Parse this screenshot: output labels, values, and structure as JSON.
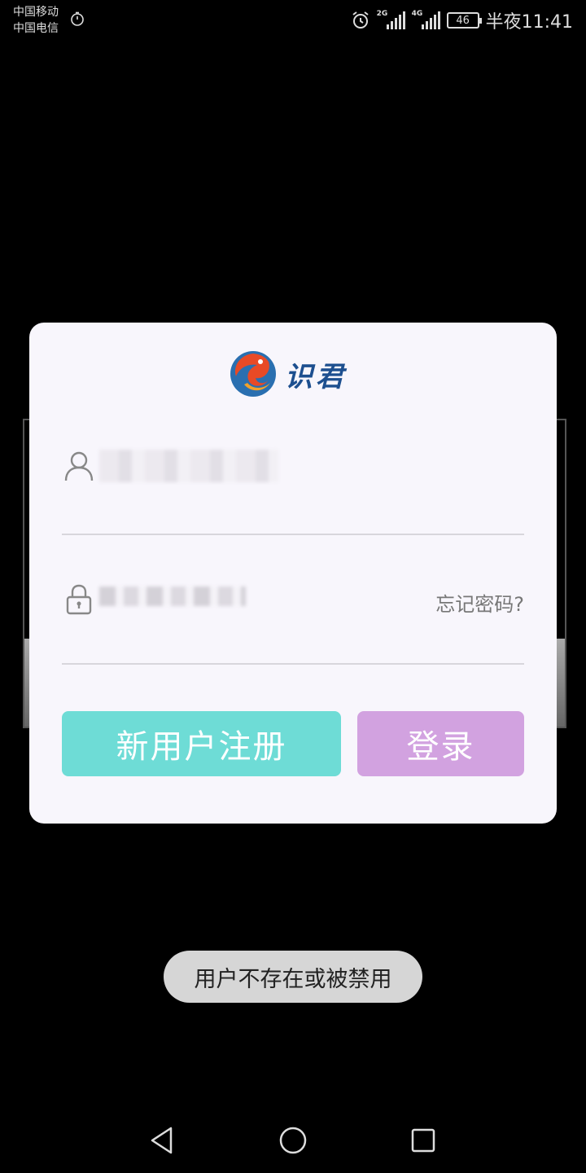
{
  "status_bar": {
    "carrier_1": "中国移动",
    "carrier_2": "中国电信",
    "signal_1_tag": "2G",
    "signal_2_tag": "4G",
    "battery": "46",
    "time": "半夜11:41"
  },
  "dialog": {
    "logo_text": "识君",
    "username_value": "",
    "password_value": "",
    "forgot_password": "忘记密码?",
    "register_button": "新用户注册",
    "login_button": "登录"
  },
  "toast": {
    "message": "用户不存在或被禁用"
  },
  "colors": {
    "register": "#6edcd6",
    "login": "#d2a2e0",
    "dialog_bg": "#f8f6fc",
    "logo_text": "#1d4f8f"
  },
  "icons": {
    "user": "user-icon",
    "lock": "lock-icon",
    "alarm": "alarm-icon",
    "timer": "timer-icon",
    "back": "back-icon",
    "home": "home-icon",
    "recent": "recent-apps-icon"
  }
}
